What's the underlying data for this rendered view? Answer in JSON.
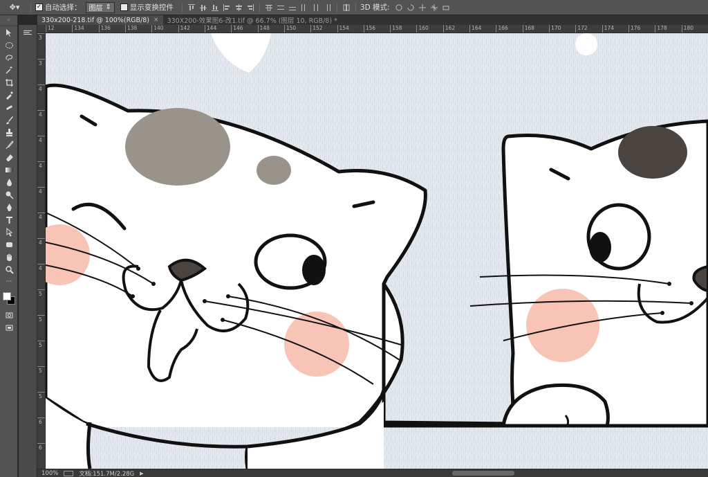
{
  "options_bar": {
    "tool_preset_icon": "move-tool-icon",
    "auto_select_label": "自动选择：",
    "auto_select_checked": true,
    "auto_select_value": "图层",
    "show_transform_label": "显示变换控件",
    "show_transform_checked": false,
    "mode_3d_label": "3D 模式:"
  },
  "tabs": [
    {
      "label": "330x200-218.tif @ 100%(RGB/8)",
      "active": true
    },
    {
      "label": "330X200-效果图6-改1.tif @ 66.7% (图层 10, RGB/8) *",
      "active": false
    }
  ],
  "ruler_top": [
    "12",
    "134",
    "136",
    "138",
    "140",
    "142",
    "144",
    "146",
    "148",
    "150",
    "152",
    "154",
    "156",
    "158",
    "160",
    "162",
    "164",
    "166",
    "168",
    "170",
    "172",
    "174",
    "176",
    "178",
    "180"
  ],
  "ruler_left": [
    "3",
    "3",
    "4",
    "4",
    "4",
    "4",
    "4",
    "4",
    "4",
    "4",
    "5",
    "5",
    "5",
    "5",
    "5",
    "6",
    "6"
  ],
  "status": {
    "zoom": "100%",
    "doc_size": "文档:151.7M/2.28G"
  },
  "toolbar_icons": [
    "move-icon",
    "marquee-icon",
    "lasso-icon",
    "magic-wand-icon",
    "crop-icon",
    "eyedropper-icon",
    "healing-brush-icon",
    "brush-icon",
    "clone-stamp-icon",
    "history-brush-icon",
    "eraser-icon",
    "gradient-icon",
    "blur-icon",
    "dodge-icon",
    "pen-icon",
    "type-icon",
    "path-select-icon",
    "shape-icon",
    "hand-icon",
    "zoom-icon"
  ],
  "colors": {
    "foreground": "#ffffff",
    "background": "#000000",
    "canvas_bg": "#e3e8ee",
    "spot_dark": "#4a4440",
    "spot_grey": "#9a938c",
    "blush": "#f7c4b6"
  }
}
